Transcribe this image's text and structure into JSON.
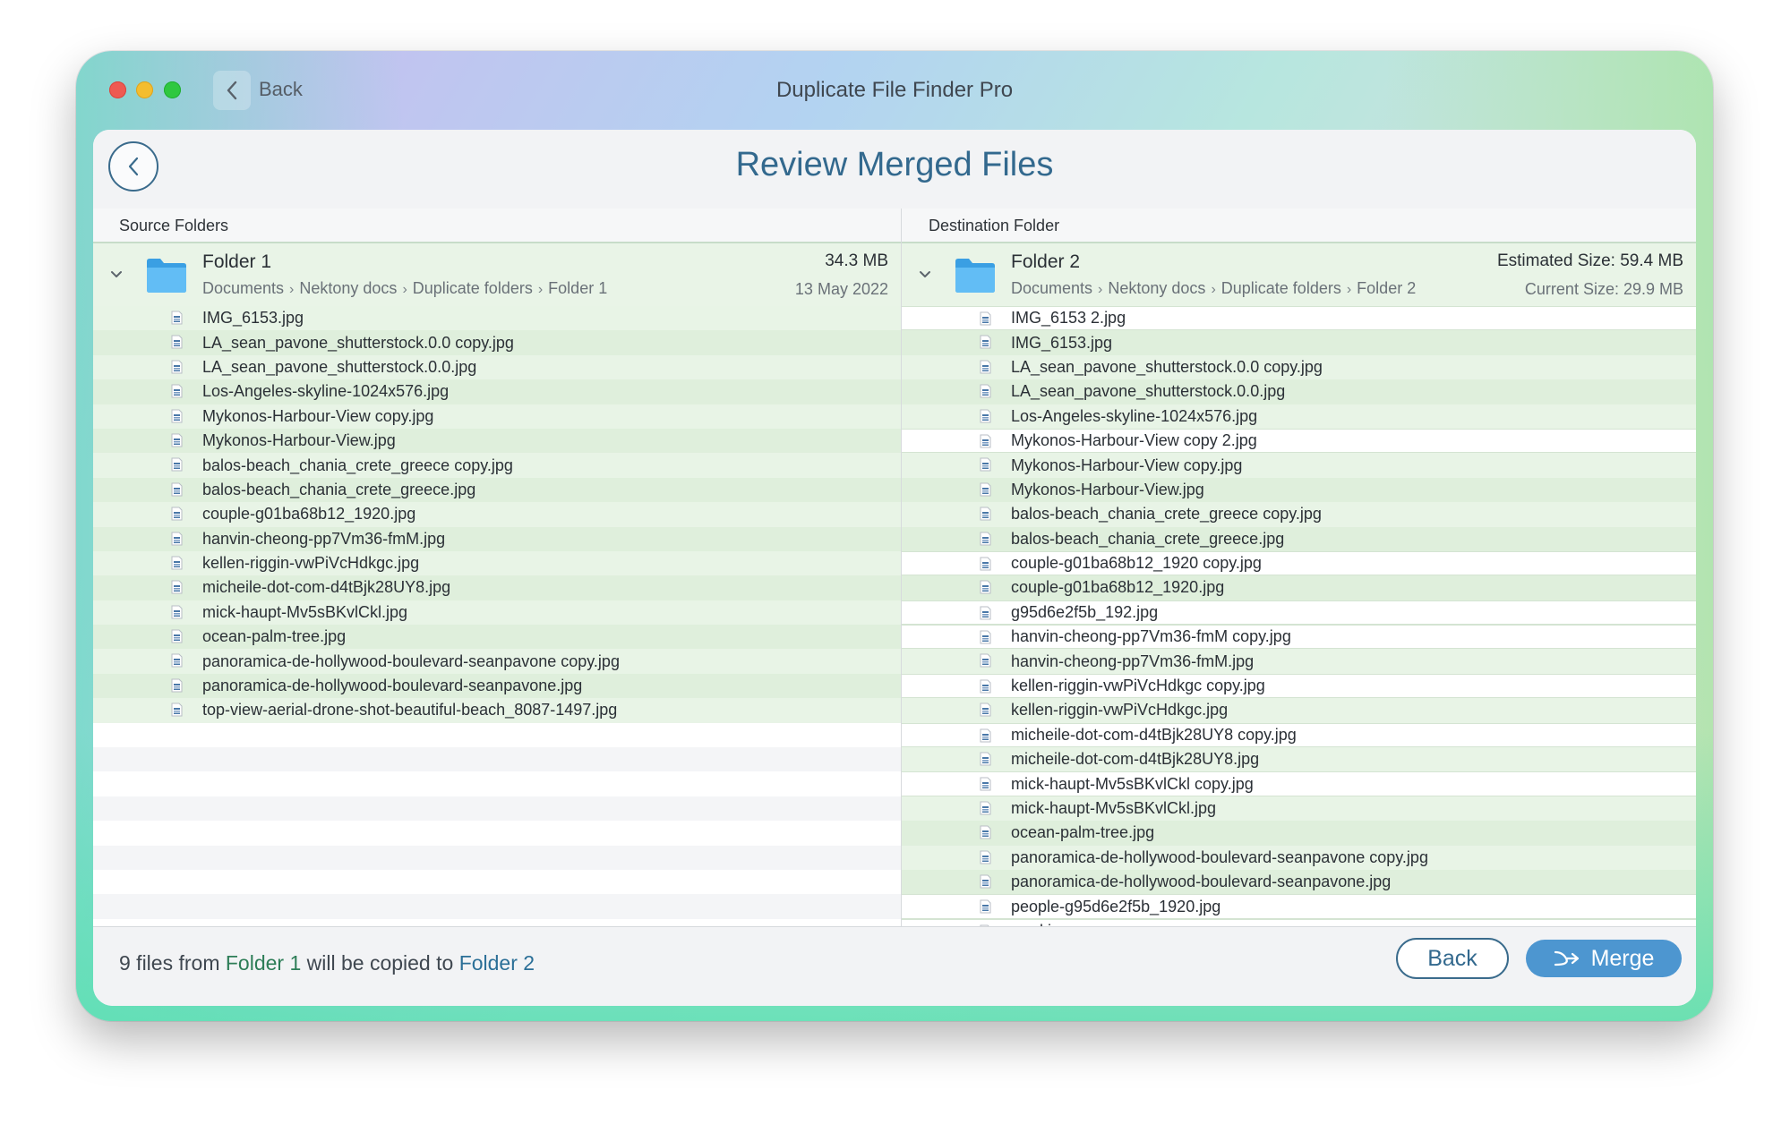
{
  "window": {
    "title": "Duplicate File Finder Pro",
    "back_label": "Back"
  },
  "header": {
    "title": "Review Merged Files"
  },
  "source": {
    "column_label": "Source Folders",
    "folder_name": "Folder 1",
    "breadcrumb": [
      "Documents",
      "Nektony docs",
      "Duplicate folders",
      "Folder 1"
    ],
    "size": "34.3 MB",
    "date": "13 May 2022",
    "files": [
      "IMG_6153.jpg",
      "LA_sean_pavone_shutterstock.0.0 copy.jpg",
      "LA_sean_pavone_shutterstock.0.0.jpg",
      "Los-Angeles-skyline-1024x576.jpg",
      "Mykonos-Harbour-View copy.jpg",
      "Mykonos-Harbour-View.jpg",
      "balos-beach_chania_crete_greece copy.jpg",
      "balos-beach_chania_crete_greece.jpg",
      "couple-g01ba68b12_1920.jpg",
      "hanvin-cheong-pp7Vm36-fmM.jpg",
      "kellen-riggin-vwPiVcHdkgc.jpg",
      "micheile-dot-com-d4tBjk28UY8.jpg",
      "mick-haupt-Mv5sBKvlCkl.jpg",
      "ocean-palm-tree.jpg",
      "panoramica-de-hollywood-boulevard-seanpavone copy.jpg",
      "panoramica-de-hollywood-boulevard-seanpavone.jpg",
      "top-view-aerial-drone-shot-beautiful-beach_8087-1497.jpg"
    ]
  },
  "destination": {
    "column_label": "Destination Folder",
    "folder_name": "Folder 2",
    "breadcrumb": [
      "Documents",
      "Nektony docs",
      "Duplicate folders",
      "Folder 2"
    ],
    "estimated_size": "Estimated Size: 59.4 MB",
    "current_size": "Current Size: 29.9 MB",
    "files": [
      {
        "name": "IMG_6153 2.jpg",
        "new": true
      },
      {
        "name": "IMG_6153.jpg",
        "new": false
      },
      {
        "name": "LA_sean_pavone_shutterstock.0.0 copy.jpg",
        "new": false
      },
      {
        "name": "LA_sean_pavone_shutterstock.0.0.jpg",
        "new": false
      },
      {
        "name": "Los-Angeles-skyline-1024x576.jpg",
        "new": false
      },
      {
        "name": "Mykonos-Harbour-View copy 2.jpg",
        "new": true
      },
      {
        "name": "Mykonos-Harbour-View copy.jpg",
        "new": false
      },
      {
        "name": "Mykonos-Harbour-View.jpg",
        "new": false
      },
      {
        "name": "balos-beach_chania_crete_greece copy.jpg",
        "new": false
      },
      {
        "name": "balos-beach_chania_crete_greece.jpg",
        "new": false
      },
      {
        "name": "couple-g01ba68b12_1920 copy.jpg",
        "new": true
      },
      {
        "name": "couple-g01ba68b12_1920.jpg",
        "new": false
      },
      {
        "name": "g95d6e2f5b_192.jpg",
        "new": true
      },
      {
        "name": "hanvin-cheong-pp7Vm36-fmM copy.jpg",
        "new": true
      },
      {
        "name": "hanvin-cheong-pp7Vm36-fmM.jpg",
        "new": false
      },
      {
        "name": "kellen-riggin-vwPiVcHdkgc copy.jpg",
        "new": true
      },
      {
        "name": "kellen-riggin-vwPiVcHdkgc.jpg",
        "new": false
      },
      {
        "name": "micheile-dot-com-d4tBjk28UY8 copy.jpg",
        "new": true
      },
      {
        "name": "micheile-dot-com-d4tBjk28UY8.jpg",
        "new": false
      },
      {
        "name": "mick-haupt-Mv5sBKvlCkl copy.jpg",
        "new": true
      },
      {
        "name": "mick-haupt-Mv5sBKvlCkl.jpg",
        "new": false
      },
      {
        "name": "ocean-palm-tree.jpg",
        "new": false
      },
      {
        "name": "panoramica-de-hollywood-boulevard-seanpavone copy.jpg",
        "new": false
      },
      {
        "name": "panoramica-de-hollywood-boulevard-seanpavone.jpg",
        "new": false
      },
      {
        "name": "people-g95d6e2f5b_1920.jpg",
        "new": true
      },
      {
        "name": "road.jpg",
        "new": true
      }
    ]
  },
  "footer": {
    "summary_prefix": "9 files from",
    "source_name": "Folder 1",
    "summary_middle": "will be copied to",
    "dest_name": "Folder 2",
    "back_label": "Back",
    "merge_label": "Merge"
  },
  "colors": {
    "accent": "#33698e",
    "merge_button": "#4d96d0",
    "row_highlight": "#e8f4e6",
    "source_name": "#2d7d57",
    "dest_name": "#2b6f97"
  },
  "icons": {
    "nav_back": "chevron-left-icon",
    "folder": "folder-icon",
    "file": "image-file-icon",
    "merge": "merge-arrow-icon",
    "disclosure": "chevron-down-icon"
  }
}
